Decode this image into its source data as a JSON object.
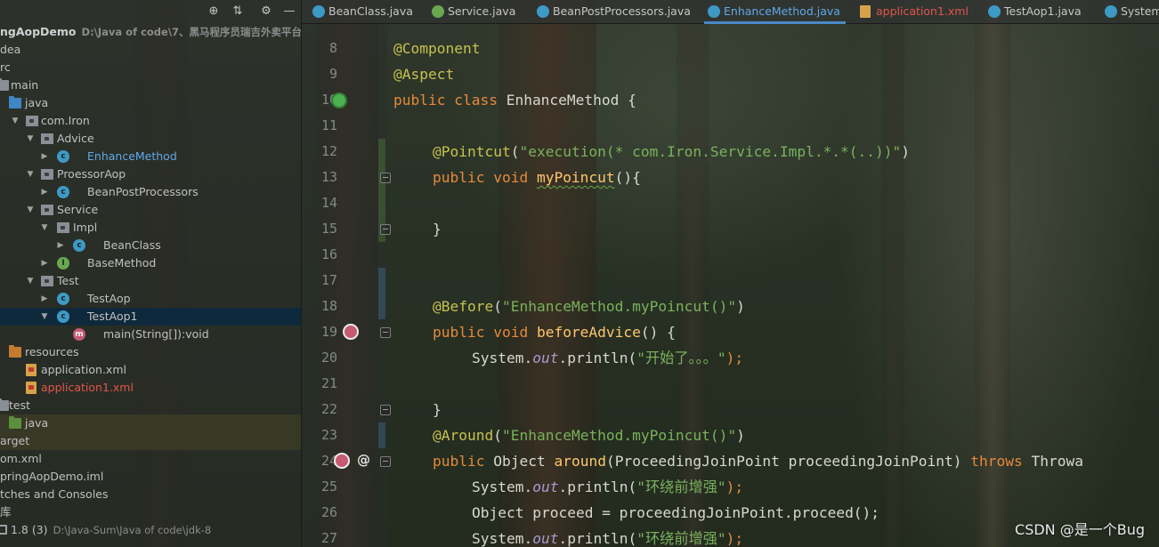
{
  "project_tree": {
    "rows": [
      {
        "label": "ngAopDemo",
        "hint": "D:\\Java of code\\7、黑马程序员瑞吉外卖平台实"
      },
      {
        "label": "dea"
      },
      {
        "label": "rc"
      },
      {
        "label": "main"
      },
      {
        "label": "java"
      },
      {
        "label": "com.Iron"
      },
      {
        "label": "Advice"
      },
      {
        "label": "EnhanceMethod"
      },
      {
        "label": "ProessorAop"
      },
      {
        "label": "BeanPostProcessors"
      },
      {
        "label": "Service"
      },
      {
        "label": "Impl"
      },
      {
        "label": "BeanClass"
      },
      {
        "label": "BaseMethod"
      },
      {
        "label": "Test"
      },
      {
        "label": "TestAop"
      },
      {
        "label": "TestAop1"
      },
      {
        "label": "main(String[]):void"
      },
      {
        "label": "resources"
      },
      {
        "label": "application.xml"
      },
      {
        "label": "application1.xml"
      },
      {
        "label": "test"
      },
      {
        "label": "java"
      },
      {
        "label": "arget"
      },
      {
        "label": "om.xml"
      },
      {
        "label": "pringAopDemo.iml"
      },
      {
        "label": "tches and Consoles"
      },
      {
        "label": "库"
      },
      {
        "label": "1.8 (3)",
        "hint": "D:\\Java-Sum\\Java of code\\jdk-8"
      }
    ]
  },
  "tabs": [
    {
      "label": "BeanClass.java"
    },
    {
      "label": "Service.java"
    },
    {
      "label": "BeanPostProcessors.java"
    },
    {
      "label": "EnhanceMethod.java"
    },
    {
      "label": "application1.xml"
    },
    {
      "label": "TestAop1.java"
    },
    {
      "label": "System."
    }
  ],
  "editor": {
    "line_numbers": [
      "8",
      "9",
      "10",
      "11",
      "12",
      "13",
      "14",
      "15",
      "16",
      "17",
      "18",
      "19",
      "20",
      "21",
      "22",
      "23",
      "24",
      "25",
      "26",
      "27"
    ],
    "code": {
      "l8": "@Component",
      "l9": "@Aspect",
      "l10": [
        "public class ",
        "EnhanceMethod {"
      ],
      "l12": [
        "@Pointcut",
        "(",
        "\"execution(* com.Iron.Service.Impl.*.*(..))\"",
        ")"
      ],
      "l13": [
        "public void ",
        "myPoincut",
        "(){"
      ],
      "l15": "}",
      "l18": [
        "@Before",
        "(",
        "\"EnhanceMethod.myPoincut()\"",
        ")"
      ],
      "l19": [
        "public void ",
        "beforeAdvice",
        "() {"
      ],
      "l20": [
        "System.",
        "out",
        ".println(",
        "\"开始了。。。\"",
        ");"
      ],
      "l22": "}",
      "l23": [
        "@Around",
        "(",
        "\"EnhanceMethod.myPoincut()\"",
        ")"
      ],
      "l24": [
        "public ",
        "Object ",
        "around",
        "(ProceedingJoinPoint proceedingJoinPoint) ",
        "throws ",
        "Throwa"
      ],
      "l25": [
        "System.",
        "out",
        ".println(",
        "\"环绕前增强\"",
        ");"
      ],
      "l26": [
        "Object proceed = proceedingJoinPoint.proceed();"
      ],
      "l27": [
        "System.",
        "out",
        ".println(",
        "\"环绕前增强\"",
        ");"
      ]
    }
  },
  "watermark": "CSDN @是一个Bug",
  "colors": {
    "keyword": "#e6893b",
    "annotation": "#c6c24c",
    "string": "#79b25c",
    "method_decl": "#ffc66d",
    "active_tab": "#5fa8e8",
    "modified_file": "#e2554a"
  }
}
